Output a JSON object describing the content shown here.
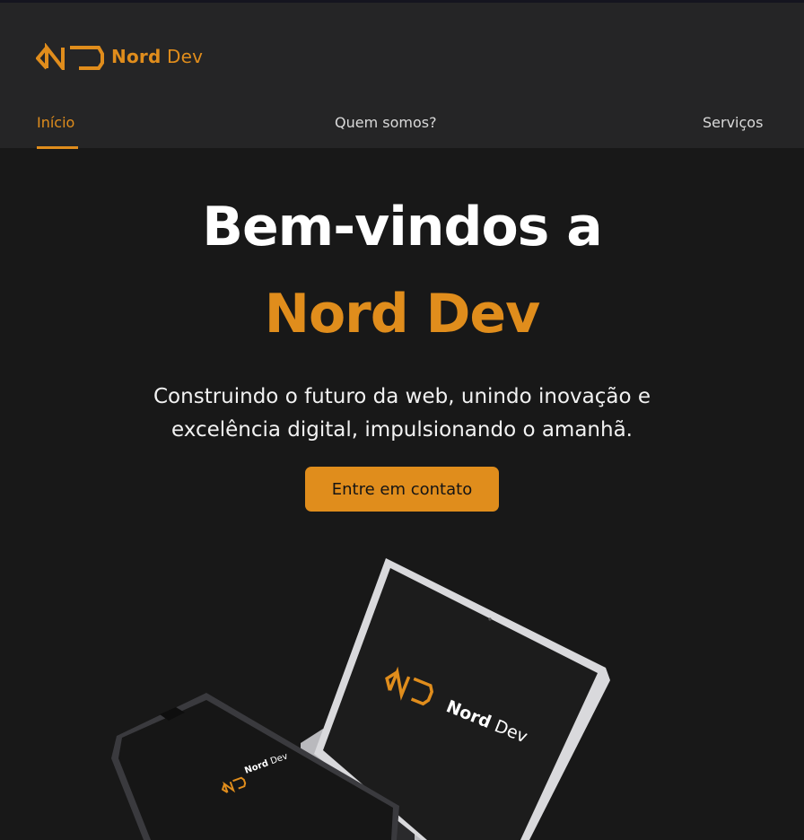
{
  "brand": {
    "name_bold": "Nord",
    "name_light": " Dev",
    "accent_color": "#e08d1c"
  },
  "nav": {
    "items": [
      {
        "label": "Início",
        "active": true
      },
      {
        "label": "Quem somos?",
        "active": false
      },
      {
        "label": "Serviços",
        "active": false
      }
    ]
  },
  "hero": {
    "title_line1": "Bem-vindos a",
    "title_line2": "Nord Dev",
    "subtitle": "Construindo o futuro da web, unindo inovação e excelência digital, impulsionando o amanhã.",
    "cta_label": "Entre em contato"
  },
  "mockup": {
    "laptop_brand_bold": "Nord",
    "laptop_brand_light": "Dev",
    "phone_brand_bold": "Nord",
    "phone_brand_light": "Dev"
  }
}
